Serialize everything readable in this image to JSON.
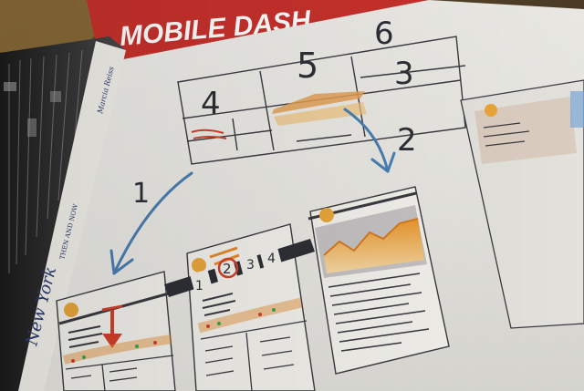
{
  "photo": {
    "banner_text": "MOBILE DASH",
    "book_spine_title": "New York",
    "book_spine_subtitle": "THEN AND NOW",
    "book_spine_author": "Marcia Reiss",
    "sketch_numbers": {
      "top_left": "4",
      "top_middle": "5",
      "top_right_upper": "6",
      "top_right_lower": "3",
      "arrow_left": "1",
      "arrow_right": "2"
    },
    "tab_numbers": [
      "1",
      "2",
      "3",
      "4"
    ],
    "colors": {
      "banner_red": "#c8312c",
      "paper": "#ecebe6",
      "sketch_orange": "#e48a2c",
      "sketch_blue": "#4a7fb3",
      "sketch_red": "#d2402a",
      "pencil": "#3a3a40"
    }
  }
}
